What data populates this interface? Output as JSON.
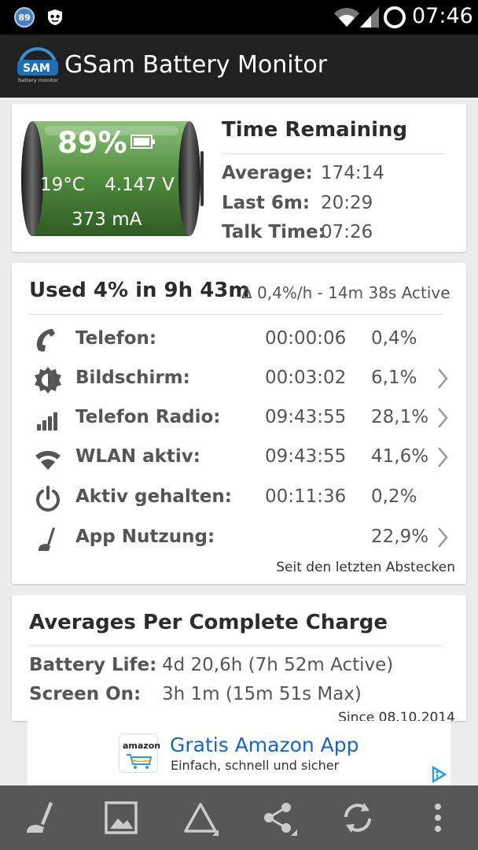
{
  "statusbar": {
    "badge_number": "89",
    "time": "07:46",
    "icons": [
      "notification-badge-icon",
      "shield-icon",
      "wifi-icon",
      "cell-signal-icon",
      "sync-ring-icon"
    ]
  },
  "appbar": {
    "title": "GSam Battery Monitor",
    "logo_text": "SAM",
    "logo_subtext": "battery monitor"
  },
  "battery": {
    "percent": "89%",
    "temperature": "19°C",
    "voltage": "4.147 V",
    "current": "373 mA",
    "fill_level": 0.89,
    "color": "#5a8a4a"
  },
  "time_remaining": {
    "title": "Time Remaining",
    "rows": [
      {
        "label": "Average:",
        "value": "174:14"
      },
      {
        "label": "Last 6m:",
        "value": "20:29"
      },
      {
        "label": "Talk Time:",
        "value": "07:26"
      }
    ]
  },
  "usage": {
    "title": "Used 4% in 9h 43m",
    "subtitle": "Δ 0,4%/h - 14m 38s Active",
    "rows": [
      {
        "icon": "phone-icon",
        "label": "Telefon:",
        "time": "00:00:06",
        "percent": "0,4%",
        "has_detail": false
      },
      {
        "icon": "brightness-icon",
        "label": "Bildschirm:",
        "time": "00:03:02",
        "percent": "6,1%",
        "has_detail": true
      },
      {
        "icon": "signal-bars-icon",
        "label": "Telefon Radio:",
        "time": "09:43:55",
        "percent": "28,1%",
        "has_detail": true
      },
      {
        "icon": "wifi-icon",
        "label": "WLAN aktiv:",
        "time": "09:43:55",
        "percent": "41,6%",
        "has_detail": true
      },
      {
        "icon": "power-icon",
        "label": "Aktiv gehalten:",
        "time": "00:11:36",
        "percent": "0,2%",
        "has_detail": false
      },
      {
        "icon": "app-usage-icon",
        "label": "App Nutzung:",
        "time": "",
        "percent": "22,9%",
        "has_detail": true
      }
    ],
    "footer": "Seit den letzten Abstecken"
  },
  "averages": {
    "title": "Averages Per Complete Charge",
    "rows": [
      {
        "label": "Battery Life:",
        "value": "4d 20,6h (7h 52m Active)"
      },
      {
        "label": "Screen On:",
        "value": "3h 1m (15m 51s Max)"
      }
    ],
    "since": "Since 08.10.2014"
  },
  "ad": {
    "logo_word": "amazon",
    "title": "Gratis Amazon App",
    "subtitle": "Einfach, schnell und sicher"
  },
  "bottombar": {
    "buttons": [
      "app-usage-icon",
      "image-icon",
      "triangle-icon",
      "share-icon",
      "refresh-icon",
      "overflow-menu-icon"
    ]
  }
}
